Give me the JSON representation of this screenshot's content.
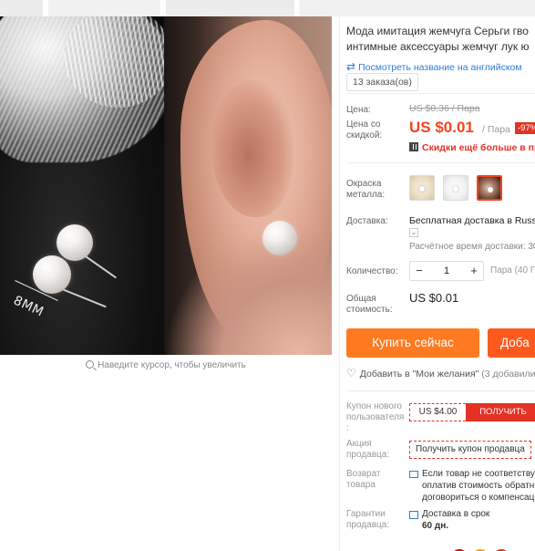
{
  "gallery": {
    "size_label": "8MM",
    "zoom_hint": "Наведите курсор, чтобы увеличить"
  },
  "product": {
    "title_line1": "Мода имитация жемчуга Серьги гво",
    "title_line2": "интимные аксессуары жемчуг лук ю",
    "translate_link": "Посмотреть название на английском",
    "orders": "13 заказа(ов)"
  },
  "price": {
    "label": "Цена:",
    "original": "US $0,36 / Пара",
    "discount_label_1": "Цена со",
    "discount_label_2": "скидкой:",
    "current": "US $0.01",
    "per": "/ Пара",
    "discount_badge": "-97%",
    "promo": "Скидки ещё больше в при"
  },
  "options": {
    "color_label_1": "Окраска",
    "color_label_2": "металла:"
  },
  "shipping": {
    "label": "Доставка:",
    "value": "Бесплатная доставка в Russ",
    "dropdown": "⌄",
    "eta": "Расчётное время доставки: 30"
  },
  "quantity": {
    "label": "Количество:",
    "minus": "−",
    "value": "1",
    "plus": "+",
    "note": "Пара (40 П"
  },
  "total": {
    "label_1": "Общая",
    "label_2": "стоимость:",
    "value": "US $0.01"
  },
  "actions": {
    "buy": "Купить сейчас",
    "cart": "Доба"
  },
  "wishlist": {
    "label": "Добавить в \"Мои желания\"",
    "count": "(3 добавили"
  },
  "coupon": {
    "label_1": "Купон нового",
    "label_2": "пользователя",
    "label_3": ":",
    "amount": "US $4.00",
    "get": "ПОЛУЧИТЬ"
  },
  "seller": {
    "label_1": "Акция",
    "label_2": "продавца:",
    "coupon": "Получить купон продавца"
  },
  "returns": {
    "label_1": "Возврат",
    "label_2": "товара",
    "line1": "Если товар не соответству",
    "line2": "оплатив стоимость обратн",
    "line3": "договориться о компенсац"
  },
  "guarantee": {
    "label_1": "Гарантии",
    "label_2": "продавца:",
    "line1": "Доставка в срок",
    "line2": "60 дн."
  }
}
